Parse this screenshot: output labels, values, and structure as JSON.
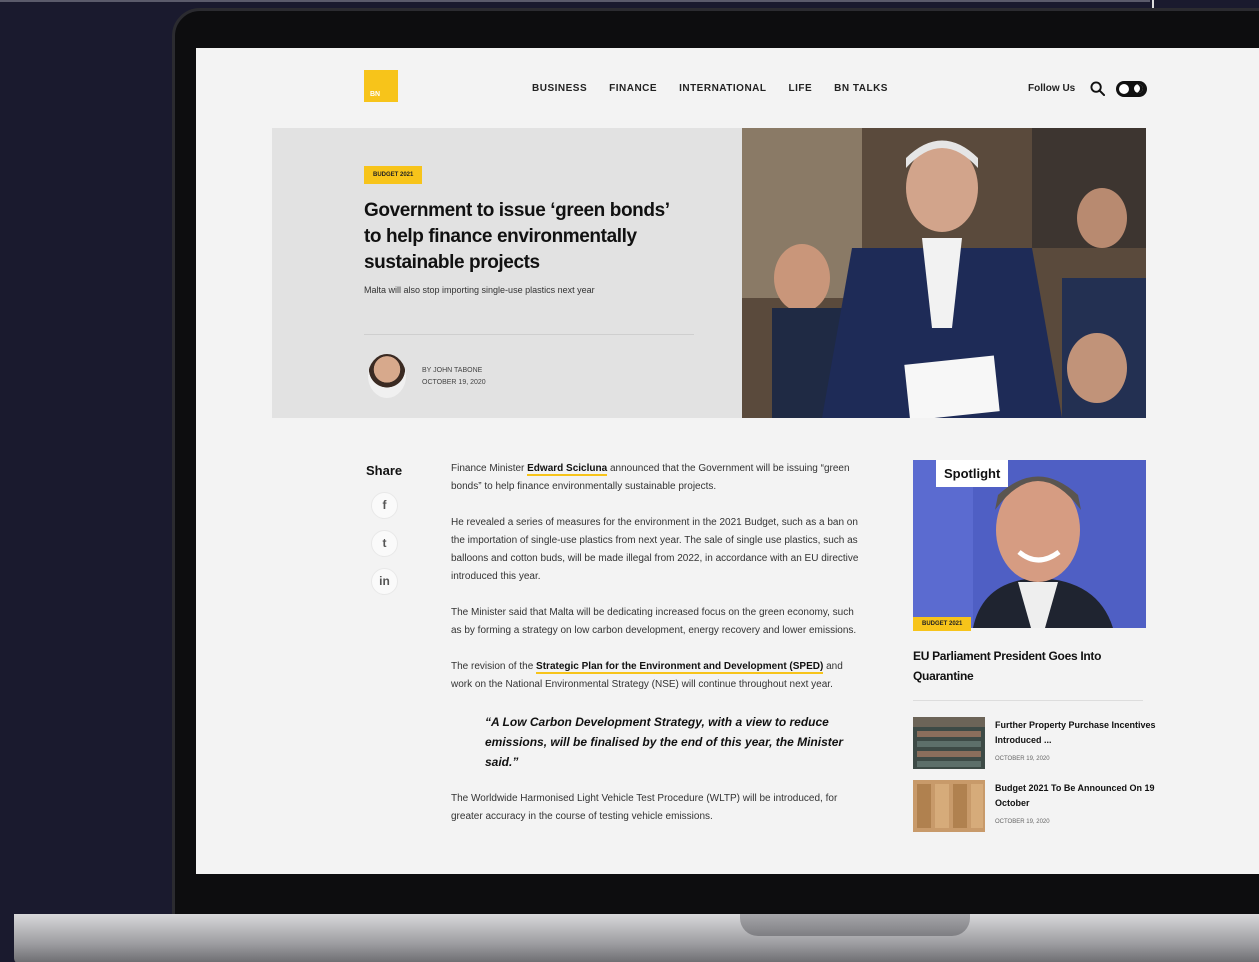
{
  "site": {
    "logo_text": "BN",
    "nav": [
      "BUSINESS",
      "FINANCE",
      "INTERNATIONAL",
      "LIFE",
      "BN TALKS"
    ],
    "follow_label": "Follow Us"
  },
  "hero": {
    "tag": "BUDGET 2021",
    "title": "Government to issue ‘green bonds’ to help finance environmentally sustainable projects",
    "subtitle": "Malta will also stop importing single-use plastics next year",
    "author": "BY JOHN TABONE",
    "date": "OCTOBER 19, 2020"
  },
  "share": {
    "label": "Share",
    "buttons": [
      "f",
      "t",
      "in"
    ]
  },
  "article": {
    "p1_pre": "Finance Minister ",
    "p1_link": "Edward Scicluna",
    "p1_post": " announced that the Government will be issuing “green bonds” to help finance environmentally sustainable projects.",
    "p2": "He revealed a series of measures for the environment in the 2021 Budget, such as a ban on the importation of single-use plastics from next year. The sale of single use plastics, such as balloons and cotton buds, will be made illegal from 2022, in accordance with an EU directive introduced this year.",
    "p3": "The Minister said that Malta will be dedicating increased focus on the green economy, such as by forming a strategy on low carbon development, energy recovery and lower emissions.",
    "p4_pre": "The revision of the ",
    "p4_link": "Strategic Plan for the Environment and Development (SPED)",
    "p4_post": " and work on the National Environmental Strategy (NSE) will continue throughout next year.",
    "quote": "“A Low Carbon Development Strategy, with a view to reduce emissions, will be finalised by the end of this year, the Minister said.”",
    "p5": "The Worldwide Harmonised Light Vehicle Test Procedure (WLTP) will be introduced, for greater accuracy in the course of testing vehicle emissions."
  },
  "sidebar": {
    "spotlight_label": "Spotlight",
    "spot_tag": "BUDGET 2021",
    "spot_title": "EU Parliament President Goes Into Quarantine",
    "items": [
      {
        "title": "Further Property Purchase Incentives Introduced ...",
        "date": "OCTOBER 19, 2020"
      },
      {
        "title": "Budget 2021 To Be Announced On 19 October",
        "date": "OCTOBER 19, 2020"
      }
    ]
  },
  "colors": {
    "accent": "#f7c41a",
    "background": "#1a1a2e",
    "screen": "#f3f3f3"
  }
}
